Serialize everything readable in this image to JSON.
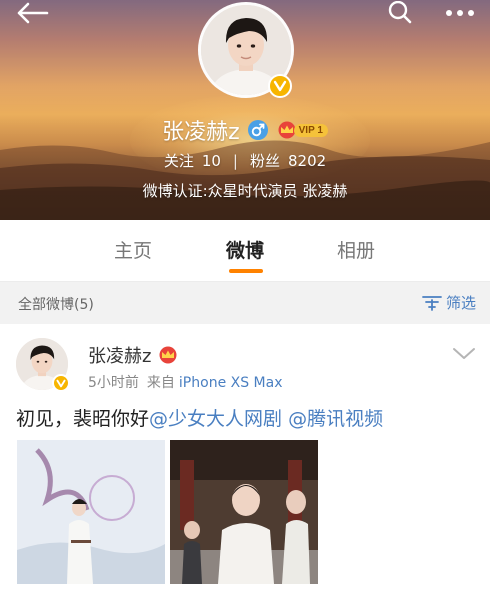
{
  "profile": {
    "name": "张凌赫z",
    "vip_label": "VIP 1",
    "following_label": "关注",
    "following_count": "10",
    "followers_label": "粉丝",
    "followers_count": "8202",
    "verification": "微博认证:众星时代演员 张凌赫"
  },
  "tabs": [
    {
      "label": "主页",
      "active": false
    },
    {
      "label": "微博",
      "active": true
    },
    {
      "label": "相册",
      "active": false
    }
  ],
  "filter": {
    "all_weibo_label": "全部微博(5)",
    "filter_label": "筛选"
  },
  "post": {
    "author": "张凌赫z",
    "time": "5小时前",
    "source_prefix": "来自",
    "device": "iPhone XS Max",
    "text_plain": "初见，裴昭你好",
    "mention_1": "@少女大人网剧",
    "mention_2": "@腾讯视频"
  },
  "colors": {
    "accent_orange": "#ff8200",
    "link_blue": "#4a7fc1",
    "verified_gold": "#f7b500",
    "gender_blue": "#4aa0e6"
  },
  "icons": {
    "back": "back-arrow-icon",
    "search": "search-icon",
    "more": "more-dots-icon",
    "gender": "male-icon",
    "vip": "crown-icon",
    "verified": "verified-v-icon",
    "filter": "filter-icon",
    "chevron": "chevron-down-icon"
  }
}
